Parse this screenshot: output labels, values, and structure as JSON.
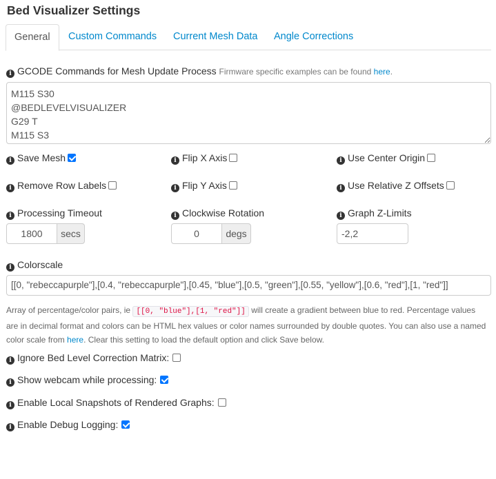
{
  "page_title": "Bed Visualizer Settings",
  "tabs": [
    {
      "label": "General",
      "active": true
    },
    {
      "label": "Custom Commands"
    },
    {
      "label": "Current Mesh Data"
    },
    {
      "label": "Angle Corrections"
    }
  ],
  "gcode": {
    "label": "GCODE Commands for Mesh Update Process",
    "note": "Firmware specific examples can be found",
    "note_link": "here",
    "note_end": ".",
    "value": "M115 S30\n@BEDLEVELVISUALIZER\nG29 T\nM115 S3"
  },
  "checkboxes": {
    "save_mesh": {
      "label": "Save Mesh",
      "checked": true
    },
    "flip_x": {
      "label": "Flip X Axis",
      "checked": false
    },
    "center_origin": {
      "label": "Use Center Origin",
      "checked": false
    },
    "remove_row_labels": {
      "label": "Remove Row Labels",
      "checked": false
    },
    "flip_y": {
      "label": "Flip Y Axis",
      "checked": false
    },
    "relative_z": {
      "label": "Use Relative Z Offsets",
      "checked": false
    }
  },
  "timeout": {
    "label": "Processing Timeout",
    "value": "1800",
    "unit": "secs"
  },
  "rotation": {
    "label": "Clockwise Rotation",
    "value": "0",
    "unit": "degs"
  },
  "zlimits": {
    "label": "Graph Z-Limits",
    "value": "-2,2"
  },
  "colorscale": {
    "label": "Colorscale",
    "value": "[[0, \"rebeccapurple\"],[0.4, \"rebeccapurple\"],[0.45, \"blue\"],[0.5, \"green\"],[0.55, \"yellow\"],[0.6, \"red\"],[1, \"red\"]]",
    "help_start": "Array of percentage/color pairs, ie",
    "help_code": "[[0, \"blue\"],[1, \"red\"]]",
    "help_mid": "will create a gradient between blue to red. Percentage values are in decimal format and colors can be HTML hex values or color names surrounded by double quotes. You can also use a named color scale from",
    "help_link": "here",
    "help_end": ". Clear this setting to load the default option and click Save below."
  },
  "options": {
    "ignore_matrix": {
      "label": "Ignore Bed Level Correction Matrix:",
      "checked": false
    },
    "show_webcam": {
      "label": "Show webcam while processing:",
      "checked": true
    },
    "snapshots": {
      "label": "Enable Local Snapshots of Rendered Graphs:",
      "checked": false
    },
    "debug": {
      "label": "Enable Debug Logging:",
      "checked": true
    }
  },
  "colors": {
    "link": "#0088cc",
    "checkbox_checked": "#0075ff"
  }
}
